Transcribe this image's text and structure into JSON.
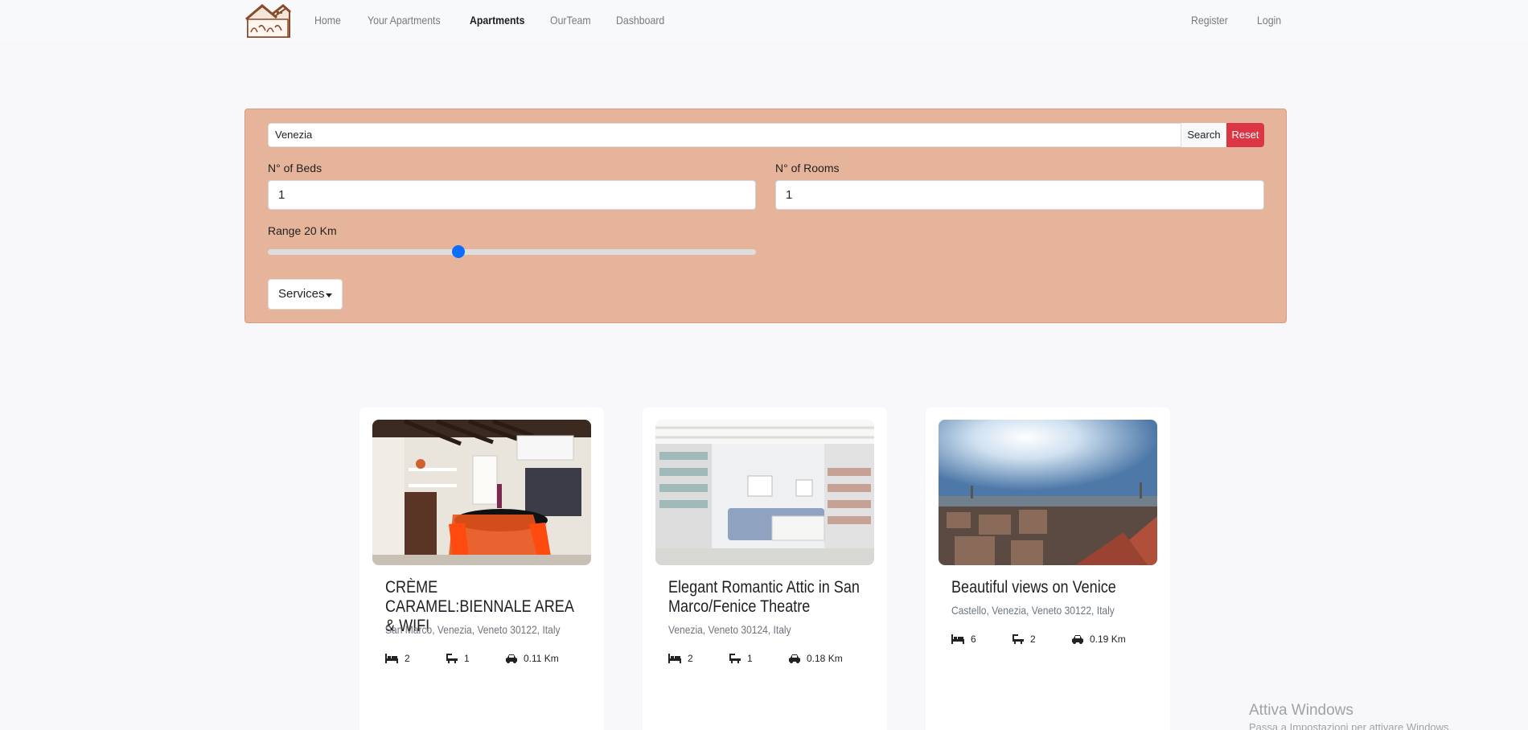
{
  "navbar": {
    "links": [
      "Home",
      "Your Apartments",
      "Apartments",
      "OurTeam",
      "Dashboard"
    ],
    "auth": [
      "Register",
      "Login"
    ],
    "active_index": 2
  },
  "search": {
    "value": "Venezia",
    "search_label": "Search",
    "reset_label": "Reset"
  },
  "filters": {
    "beds_label": "N° of Beds",
    "beds_value": "1",
    "rooms_label": "N° of Rooms",
    "rooms_value": "1",
    "range_label": "Range 20 Km",
    "range_fraction": 0.39,
    "services_label": "Services"
  },
  "apartments": [
    {
      "title": "CRÈME CARAMEL:BIENNALE AREA & WIFI",
      "address": "San Marco, Venezia, Veneto 30122, Italy",
      "beds": "2",
      "baths": "1",
      "distance": "0.11 Km"
    },
    {
      "title": "Elegant Romantic Attic in San Marco/Fenice Theatre",
      "address": "Venezia, Veneto 30124, Italy",
      "beds": "2",
      "baths": "1",
      "distance": "0.18 Km"
    },
    {
      "title": "Beautiful views on Venice",
      "address": "Castello, Venezia, Veneto 30122, Italy",
      "beds": "6",
      "baths": "2",
      "distance": "0.19 Km"
    }
  ],
  "watermark": {
    "line1": "Attiva Windows",
    "line2": "Passa a Impostazioni per attivare Windows."
  },
  "colors": {
    "panel_bg": "#e5b49a",
    "reset_bg": "#dc3545",
    "slider_thumb": "#0d6efd"
  }
}
